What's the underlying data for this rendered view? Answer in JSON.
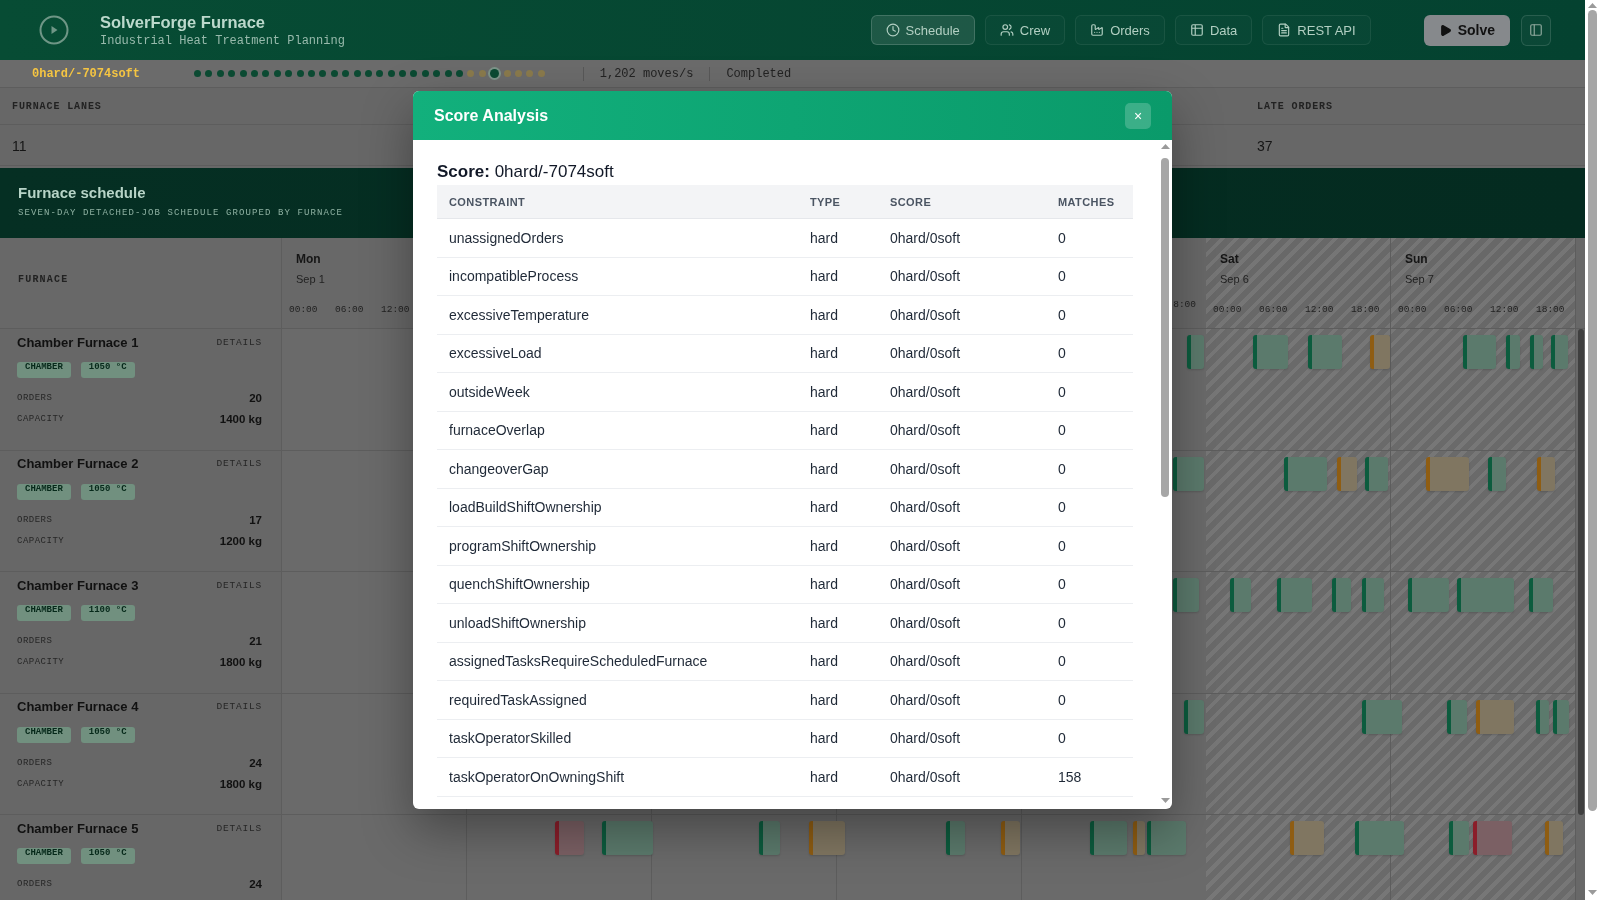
{
  "app_header": {
    "title": "SolverForge Furnace",
    "subtitle": "Industrial Heat Treatment Planning",
    "nav": [
      {
        "label": "Schedule",
        "selected": true
      },
      {
        "label": "Crew",
        "selected": false
      },
      {
        "label": "Orders",
        "selected": false
      },
      {
        "label": "Data",
        "selected": false
      },
      {
        "label": "REST API",
        "selected": false
      }
    ],
    "solve_button": "Solve"
  },
  "status_bar": {
    "score": "0hard/-7074soft",
    "progress_dots": [
      {
        "color": "#0b4a32",
        "selected": false
      },
      {
        "color": "#0b4a32",
        "selected": false
      },
      {
        "color": "#0b4a32",
        "selected": false
      },
      {
        "color": "#0b4a32",
        "selected": false
      },
      {
        "color": "#0b4a32",
        "selected": false
      },
      {
        "color": "#0b4a32",
        "selected": false
      },
      {
        "color": "#0b4a32",
        "selected": false
      },
      {
        "color": "#0b4a32",
        "selected": false
      },
      {
        "color": "#0b4a32",
        "selected": false
      },
      {
        "color": "#0b4a32",
        "selected": false
      },
      {
        "color": "#0b4a32",
        "selected": false
      },
      {
        "color": "#0b4a32",
        "selected": false
      },
      {
        "color": "#0b4a32",
        "selected": false
      },
      {
        "color": "#0b4a32",
        "selected": false
      },
      {
        "color": "#0b4a32",
        "selected": false
      },
      {
        "color": "#0b4a32",
        "selected": false
      },
      {
        "color": "#0b4a32",
        "selected": false
      },
      {
        "color": "#0b4a32",
        "selected": false
      },
      {
        "color": "#0b4a32",
        "selected": false
      },
      {
        "color": "#0b4a32",
        "selected": false
      },
      {
        "color": "#0b4a32",
        "selected": false
      },
      {
        "color": "#0b4a32",
        "selected": false
      },
      {
        "color": "#0b4a32",
        "selected": false
      },
      {
        "color": "#0b4a32",
        "selected": false
      },
      {
        "color": "#8a7a4c",
        "selected": false
      },
      {
        "color": "#8a7a4c",
        "selected": false
      },
      {
        "color": "#0b4a32",
        "selected": true
      },
      {
        "color": "#8a7a4c",
        "selected": false
      },
      {
        "color": "#8a7a4c",
        "selected": false
      },
      {
        "color": "#8a7a4c",
        "selected": false
      },
      {
        "color": "#8a7a4c",
        "selected": false
      }
    ],
    "speed": "1,202 moves/s",
    "state": "Completed"
  },
  "stats": [
    {
      "label": "FURNACE LANES",
      "value": "11"
    },
    {
      "label": "LATE ORDERS",
      "value": "37"
    }
  ],
  "schedule": {
    "title": "Furnace schedule",
    "subtitle": "SEVEN-DAY DETACHED-JOB SCHEDULE GROUPED BY FURNACE",
    "furnace_heading": "FURNACE",
    "days": [
      {
        "day": "Mon",
        "date": "Sep 1",
        "weekend": false,
        "ticks": [
          "00:00",
          "06:00",
          "12:00"
        ]
      },
      {
        "day": "Sat",
        "date": "Sep 6",
        "weekend": true,
        "ticks": [
          "00:00",
          "06:00",
          "12:00",
          "18:00"
        ]
      },
      {
        "day": "Sun",
        "date": "Sep 7",
        "weekend": true,
        "ticks": [
          "00:00",
          "06:00",
          "12:00",
          "18:00"
        ]
      }
    ],
    "partial_tick": "8:00",
    "furnaces": [
      {
        "name": "Chamber Furnace 1",
        "details": "DETAILS",
        "tags": [
          "CHAMBER",
          "1050 °C"
        ],
        "orders_label": "ORDERS",
        "orders": "20",
        "capacity_label": "CAPACITY",
        "capacity": "1400 kg"
      },
      {
        "name": "Chamber Furnace 2",
        "details": "DETAILS",
        "tags": [
          "CHAMBER",
          "1050 °C"
        ],
        "orders_label": "ORDERS",
        "orders": "17",
        "capacity_label": "CAPACITY",
        "capacity": "1200 kg"
      },
      {
        "name": "Chamber Furnace 3",
        "details": "DETAILS",
        "tags": [
          "CHAMBER",
          "1100 °C"
        ],
        "orders_label": "ORDERS",
        "orders": "21",
        "capacity_label": "CAPACITY",
        "capacity": "1800 kg"
      },
      {
        "name": "Chamber Furnace 4",
        "details": "DETAILS",
        "tags": [
          "CHAMBER",
          "1050 °C"
        ],
        "orders_label": "ORDERS",
        "orders": "24",
        "capacity_label": "CAPACITY",
        "capacity": "1800 kg"
      },
      {
        "name": "Chamber Furnace 5",
        "details": "DETAILS",
        "tags": [
          "CHAMBER",
          "1050 °C"
        ],
        "orders_label": "ORDERS",
        "orders": "24"
      }
    ]
  },
  "dialog": {
    "title": "Score Analysis",
    "close": "×",
    "score_line": "**Score:** 0hard/-7074soft",
    "columns": [
      "CONSTRAINT",
      "TYPE",
      "SCORE",
      "MATCHES"
    ],
    "rows": [
      {
        "constraint": "unassignedOrders",
        "type": "hard",
        "score": "0hard/0soft",
        "matches": "0"
      },
      {
        "constraint": "incompatibleProcess",
        "type": "hard",
        "score": "0hard/0soft",
        "matches": "0"
      },
      {
        "constraint": "excessiveTemperature",
        "type": "hard",
        "score": "0hard/0soft",
        "matches": "0"
      },
      {
        "constraint": "excessiveLoad",
        "type": "hard",
        "score": "0hard/0soft",
        "matches": "0"
      },
      {
        "constraint": "outsideWeek",
        "type": "hard",
        "score": "0hard/0soft",
        "matches": "0"
      },
      {
        "constraint": "furnaceOverlap",
        "type": "hard",
        "score": "0hard/0soft",
        "matches": "0"
      },
      {
        "constraint": "changeoverGap",
        "type": "hard",
        "score": "0hard/0soft",
        "matches": "0"
      },
      {
        "constraint": "loadBuildShiftOwnership",
        "type": "hard",
        "score": "0hard/0soft",
        "matches": "0"
      },
      {
        "constraint": "programShiftOwnership",
        "type": "hard",
        "score": "0hard/0soft",
        "matches": "0"
      },
      {
        "constraint": "quenchShiftOwnership",
        "type": "hard",
        "score": "0hard/0soft",
        "matches": "0"
      },
      {
        "constraint": "unloadShiftOwnership",
        "type": "hard",
        "score": "0hard/0soft",
        "matches": "0"
      },
      {
        "constraint": "assignedTasksRequireScheduledFurnace",
        "type": "hard",
        "score": "0hard/0soft",
        "matches": "0"
      },
      {
        "constraint": "requiredTaskAssigned",
        "type": "hard",
        "score": "0hard/0soft",
        "matches": "0"
      },
      {
        "constraint": "taskOperatorSkilled",
        "type": "hard",
        "score": "0hard/0soft",
        "matches": "0"
      },
      {
        "constraint": "taskOperatorOnOwningShift",
        "type": "hard",
        "score": "0hard/0soft",
        "matches": "158"
      }
    ]
  }
}
